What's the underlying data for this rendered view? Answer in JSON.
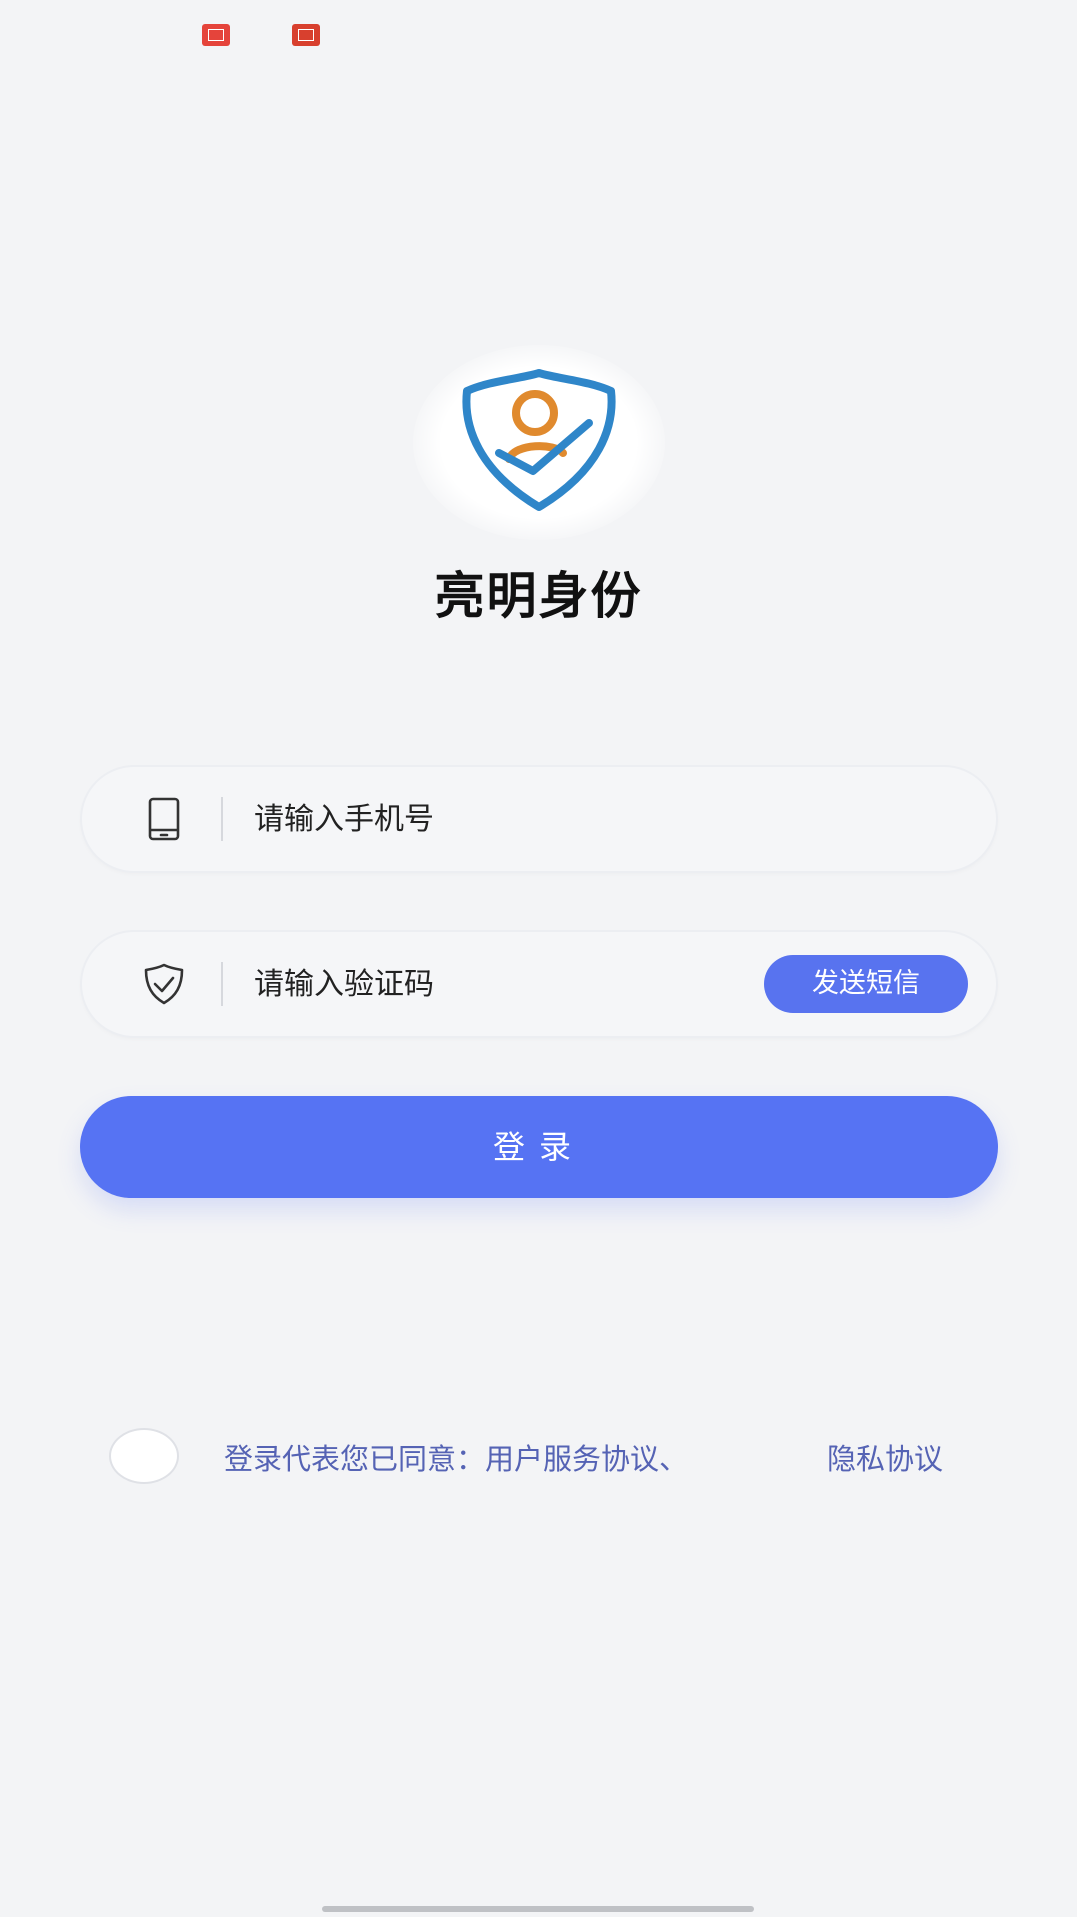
{
  "app": {
    "title": "亮明身份"
  },
  "form": {
    "phone_placeholder": "请输入手机号",
    "code_placeholder": "请输入验证码",
    "send_sms_label": "发送短信",
    "login_label": "登录"
  },
  "agreement": {
    "prefix": "登录代表您已同意：",
    "user_agreement": "用户服务协议、",
    "privacy_policy": "隐私协议"
  },
  "colors": {
    "accent": "#5673f3",
    "link": "#5563b4",
    "logo_blue": "#2f86c9",
    "logo_orange": "#e08a2e",
    "background": "#f3f4f6"
  },
  "icons": {
    "phone": "phone-icon",
    "shield": "shield-check-icon",
    "logo": "shield-person-check-logo"
  }
}
